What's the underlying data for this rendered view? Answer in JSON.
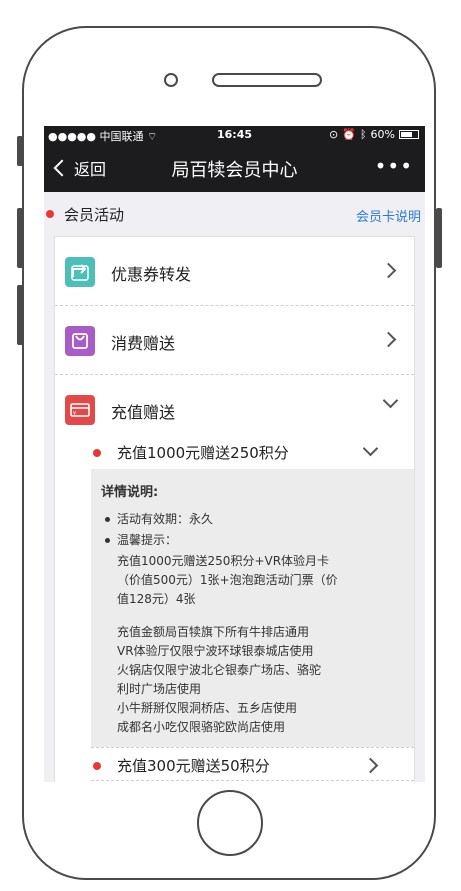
{
  "status_bar": {
    "signal": "●●●●● 中国联通",
    "time": "16:45",
    "battery": "60%"
  },
  "nav": {
    "back_label": "返回",
    "title": "局百犊会员中心",
    "more": "•••"
  },
  "section": {
    "title": "会员活动",
    "link": "会员卡说明"
  },
  "rows": [
    {
      "label": "优惠券转发",
      "icon_color": "#4dbfb8"
    },
    {
      "label": "消费赠送",
      "icon_color": "#a75cc8"
    },
    {
      "label": "充值赠送",
      "icon_color": "#e04a4a"
    }
  ],
  "recharge": {
    "items": [
      {
        "label": "充值1000元赠送250积分"
      },
      {
        "label": "充值300元赠送50积分"
      }
    ],
    "details": {
      "title": "详情说明:",
      "validity": "活动有效期：永久",
      "tips_label": "温馨提示：",
      "lines": [
        "充值1000元赠送250积分+VR体验月卡",
        "（价值500元）1张+泡泡跑活动门票（价",
        "值128元）4张"
      ],
      "notes": [
        "充值金额局百犊旗下所有牛排店通用",
        "VR体验厅仅限宁波环球银泰城店使用",
        "火锅店仅限宁波北仑银泰广场店、骆驼",
        "利时广场店使用",
        "小牛掰掰仅限洞桥店、五乡店使用",
        "成都名小吃仅限骆驼欧尚店使用"
      ]
    }
  }
}
